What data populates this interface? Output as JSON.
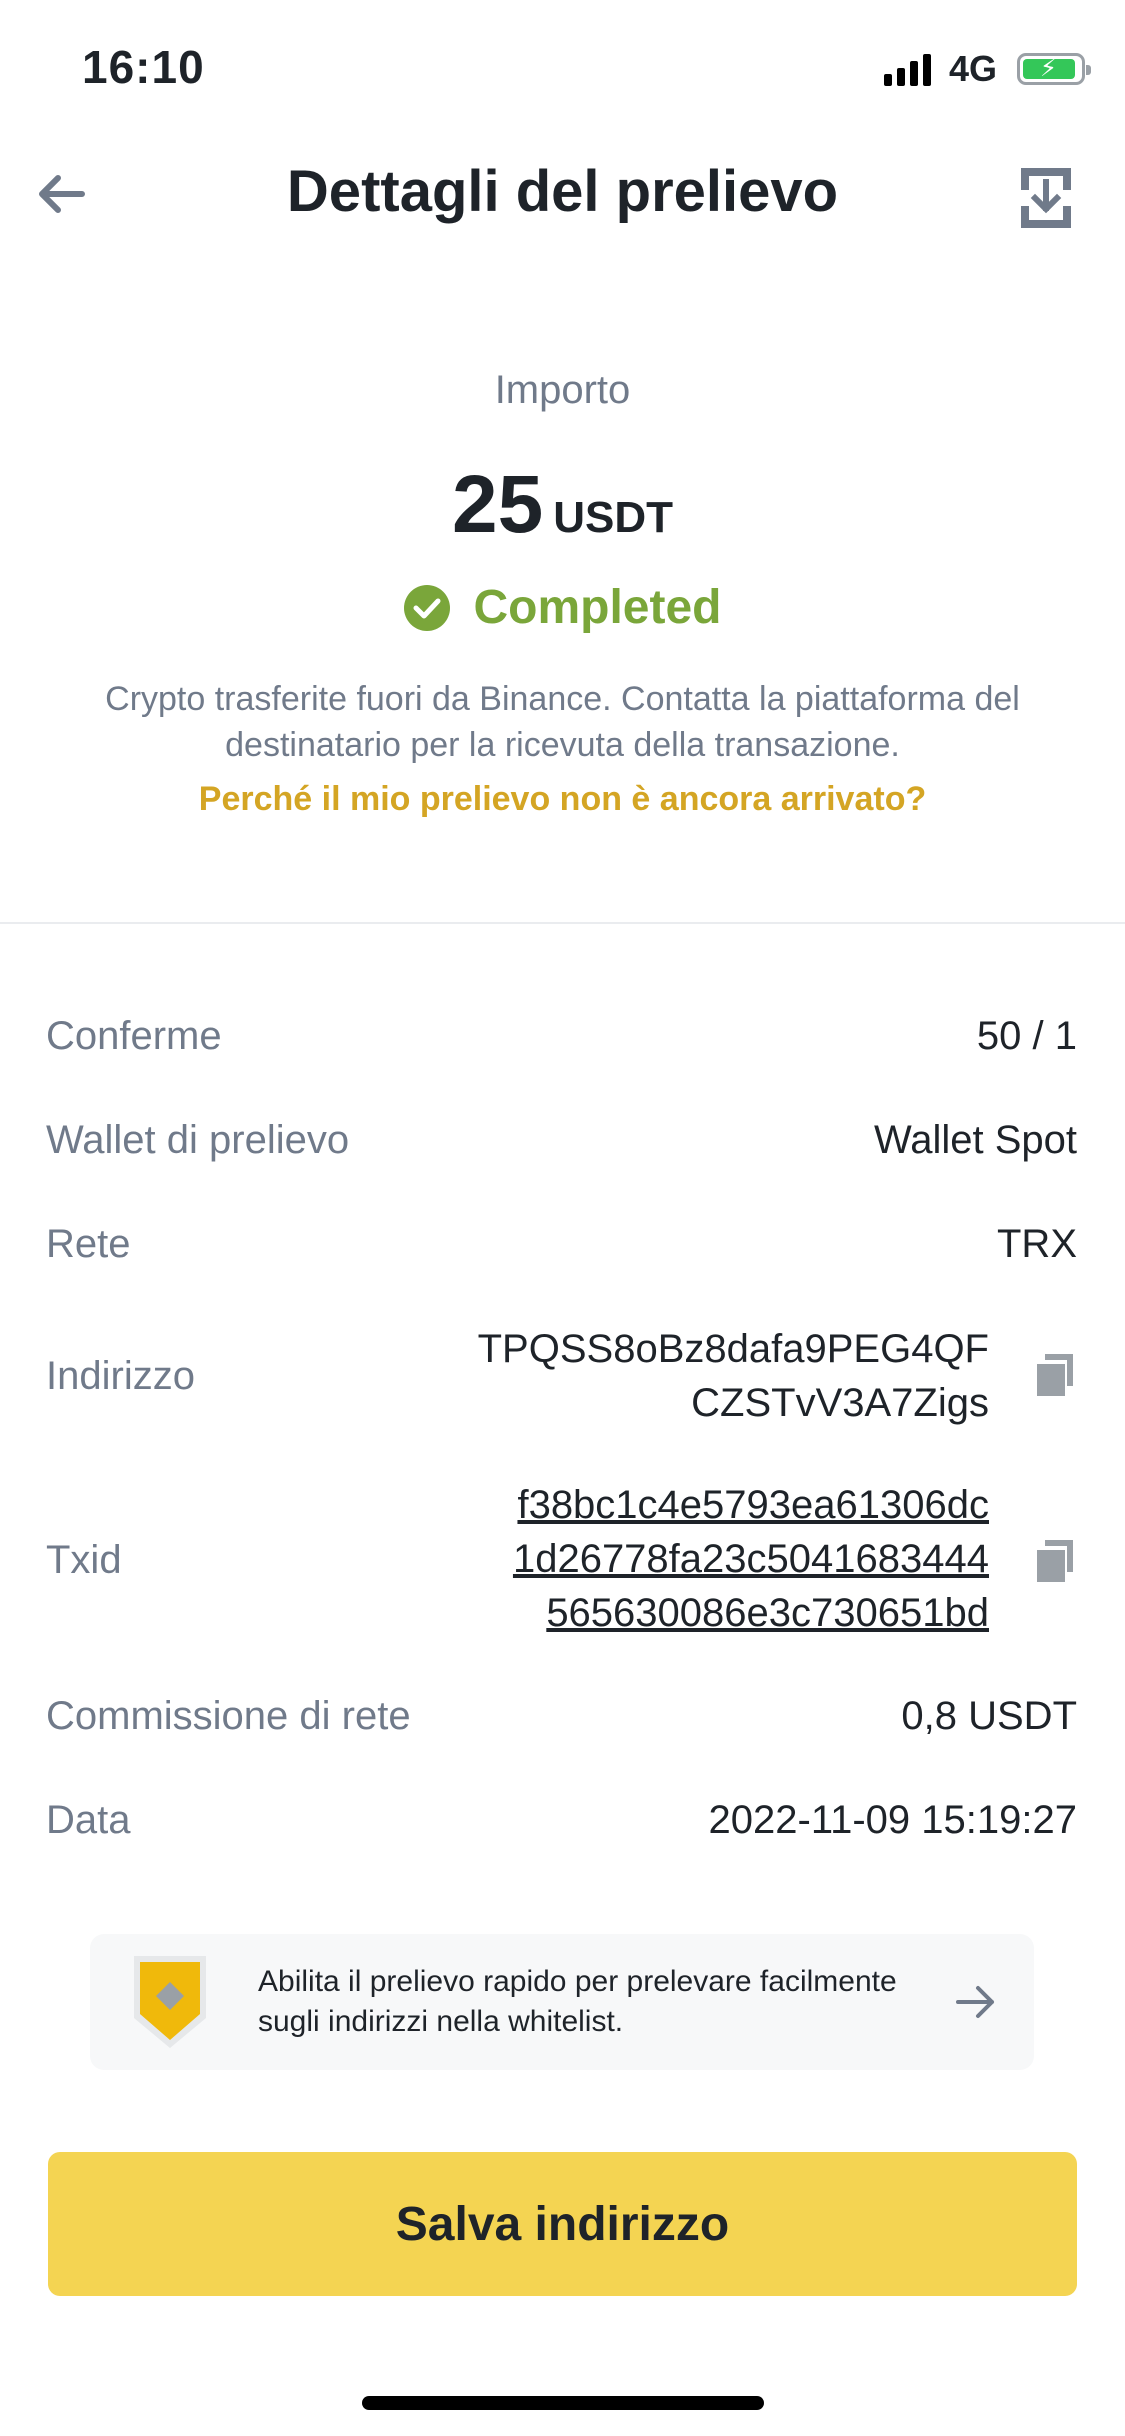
{
  "status_bar": {
    "time": "16:10",
    "network": "4G"
  },
  "header": {
    "title": "Dettagli del prelievo",
    "back_icon": "back-arrow-icon",
    "download_icon": "download-icon"
  },
  "amount": {
    "label": "Importo",
    "value": "25",
    "currency": "USDT",
    "status": "Completed",
    "status_color": "#7aa63a",
    "info": "Crypto trasferite fuori da Binance. Contatta la piattaforma del destinatario per la ricevuta della transazione.",
    "link": "Perché il mio prelievo non è ancora arrivato?",
    "link_color": "#d4a524"
  },
  "details": {
    "confirmations": {
      "label": "Conferme",
      "value": "50 / 1"
    },
    "wallet": {
      "label": "Wallet di prelievo",
      "value": "Wallet Spot"
    },
    "network": {
      "label": "Rete",
      "value": "TRX"
    },
    "address": {
      "label": "Indirizzo",
      "line1": "TPQSS8oBz8dafa9PEG4QF",
      "line2": "CZSTvV3A7Zigs"
    },
    "txid": {
      "label": "Txid",
      "line1": "f38bc1c4e5793ea61306dc",
      "line2": "1d26778fa23c5041683444",
      "line3": "565630086e3c730651bd"
    },
    "fee": {
      "label": "Commissione di rete",
      "value": "0,8 USDT"
    },
    "date": {
      "label": "Data",
      "value": "2022-11-09 15:19:27"
    }
  },
  "banner": {
    "text": "Abilita il prelievo rapido per prelevare facilmente sugli indirizzi nella whitelist.",
    "icon": "shield-icon"
  },
  "button": {
    "label": "Salva indirizzo",
    "color": "#f4d452"
  }
}
